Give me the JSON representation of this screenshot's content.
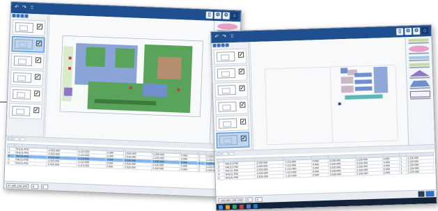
{
  "windows": [
    {
      "id": "back",
      "rows": [
        [
          "1",
          "SHL01-P00",
          "-2,520.000",
          "-1,113.000",
          "0.000",
          "2,520.000",
          "2,220.000",
          "0.000",
          "1",
          "2,220.000"
        ],
        [
          "2",
          "SHL01-P00",
          "-2,520.000",
          "-1,113.000",
          "0.000",
          "2,520.000",
          "2,220.000",
          "0.000",
          "1",
          "2,220.000"
        ],
        [
          "3",
          "SHL01-P00",
          "-2,520.000",
          "-1,113.000",
          "0.000",
          "2,520.000",
          "2,220.000",
          "0.000",
          "1",
          "2,220.000"
        ],
        [
          "4",
          "SHL01-P00",
          "-2,520.000",
          "-1,113.000",
          "0.000",
          "2,520.000",
          "2,220.000",
          "0.000",
          "1",
          "2,220.000"
        ],
        [
          "5",
          "SHL01-P00",
          "-2,520.000",
          "-1,113.000",
          "0.000",
          "2,520.000",
          "2,220.000",
          "0.000",
          "1",
          "2,220.000"
        ]
      ],
      "highlighted_row": 2,
      "status_value": "47,000,100,100",
      "status_small_1": "0",
      "status_small_2": "0"
    },
    {
      "id": "front",
      "rows": [
        [
          "1",
          "SHL01-P00",
          "-2,520.000",
          "-1,113.000",
          "0.000",
          "2,520.000",
          "2,220.000",
          "0.000",
          "1",
          "2,220.000"
        ],
        [
          "2",
          "SHL01-P00",
          "-2,520.000",
          "-1,113.000",
          "0.000",
          "2,520.000",
          "2,220.000",
          "0.000",
          "1",
          "2,220.000"
        ],
        [
          "3",
          "SHL01-P00",
          "-2,520.000",
          "-1,113.000",
          "0.000",
          "2,520.000",
          "2,220.000",
          "0.000",
          "1",
          "2,220.000"
        ],
        [
          "4",
          "SHL01-P00",
          "-2,520.000",
          "-1,113.000",
          "0.000",
          "2,520.000",
          "2,220.000",
          "0.000",
          "1",
          "2,220.000"
        ],
        [
          "5",
          "SHL01-P00",
          "-2,520.000",
          "-1,113.000",
          "0.000",
          "2,520.000",
          "2,220.000",
          "0.000",
          "1",
          "2,220.000"
        ]
      ],
      "highlighted_row": -1,
      "status_value": "-100,000,100,100",
      "status_small_1": "0",
      "status_small_2": "0"
    }
  ],
  "colors": {
    "titlebar": "#1f4f8f",
    "selection": "#bcd6f3",
    "row_highlight": "#7fb7ee",
    "plan_green": "#5aa35a",
    "plan_blue": "#6f8fcf",
    "plan_purple": "#8f74c8"
  },
  "icons": [
    "undo-icon",
    "redo-icon",
    "grid-icon",
    "gear-icon",
    "home-icon",
    "check-icon"
  ]
}
